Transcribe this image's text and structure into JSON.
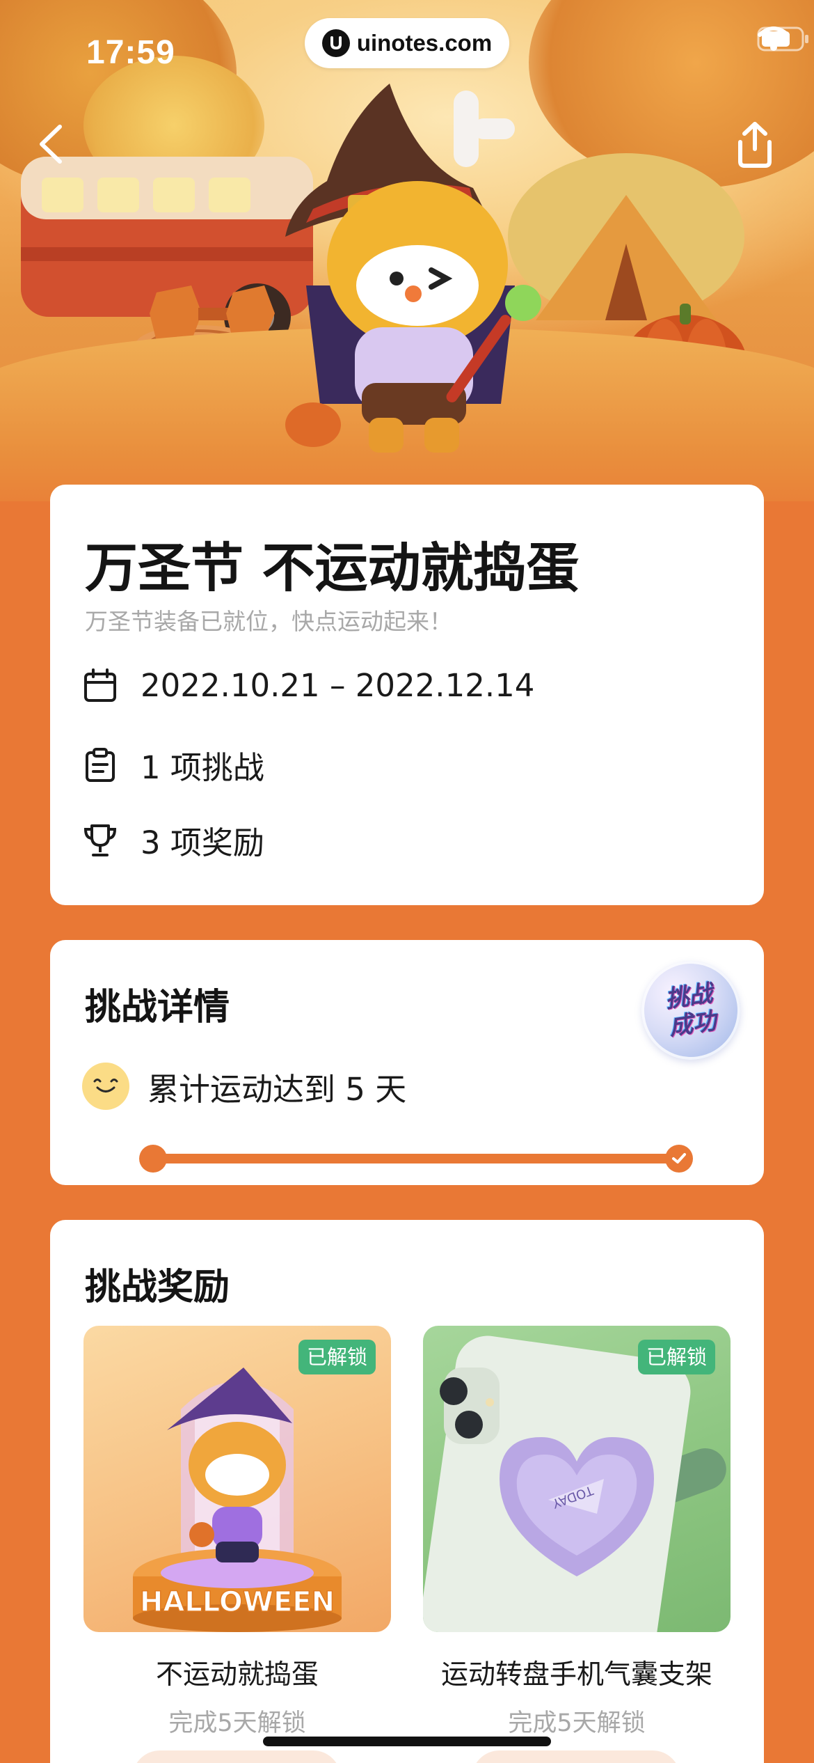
{
  "status_bar": {
    "time": "17:59",
    "url": "uinotes.com",
    "icons": [
      "wifi-icon",
      "battery-icon"
    ]
  },
  "nav": {
    "back_icon": "chevron-left-icon",
    "share_icon": "share-icon"
  },
  "event": {
    "title": "万圣节 不运动就捣蛋",
    "subtitle": "万圣节装备已就位，快点运动起来！",
    "date_range": "2022.10.21 – 2022.12.14",
    "challenges": "1 项挑战",
    "rewards": "3 项奖励"
  },
  "challenge_detail": {
    "title": "挑战详情",
    "badge_line1": "挑战",
    "badge_line2": "成功",
    "goal": "累计运动达到 5 天",
    "progress": 1.0
  },
  "rewards": {
    "title": "挑战奖励",
    "items": [
      {
        "tag": "已解锁",
        "name": "不运动就捣蛋",
        "hint": "完成5天解锁",
        "art_text": "HALLOWEEN"
      },
      {
        "tag": "已解锁",
        "name": "运动转盘手机气囊支架",
        "hint": "完成5天解锁",
        "art_text": "TODAY"
      }
    ]
  },
  "colors": {
    "background": "#e97835",
    "accent": "#e97835",
    "unlocked_tag": "#43b57a"
  }
}
